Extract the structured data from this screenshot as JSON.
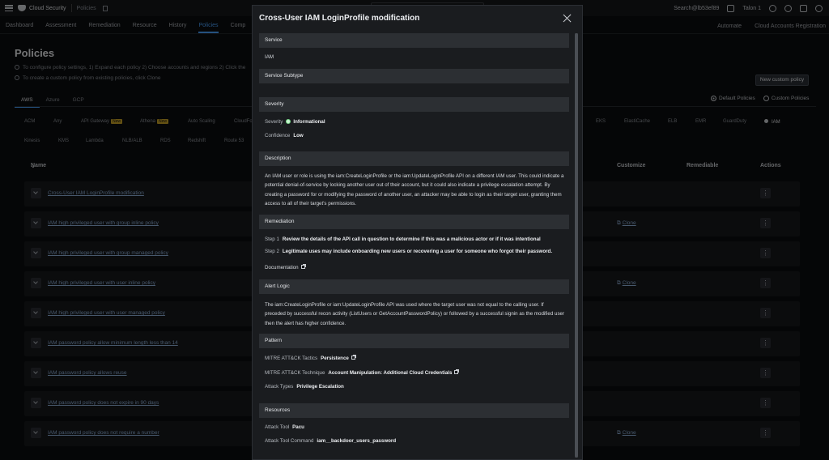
{
  "topbar": {
    "app_name": "Cloud Security",
    "crumb": "Policies",
    "search_label": "Search@lb53ef89",
    "tenant": "Talon 1"
  },
  "nav": {
    "items": [
      "Dashboard",
      "Assessment",
      "Remediation",
      "Resource",
      "History",
      "Policies",
      "Comp"
    ],
    "active": "Policies",
    "right": [
      "Automate",
      "Cloud Accounts Registration"
    ]
  },
  "page": {
    "title": "Policies",
    "hint1": "To configure policy settings, 1) Expand each policy 2) Choose accounts and regions 2) Click the",
    "hint2": "To create a custom policy from existing policies, click Clone",
    "cloud_tabs": [
      "AWS",
      "Azure",
      "GCP"
    ],
    "new_policy_btn": "New custom policy",
    "radios": [
      "Default Policies",
      "Custom Policies"
    ],
    "services_row1": [
      {
        "name": "ACM",
        "new": false
      },
      {
        "name": "Any",
        "new": false
      },
      {
        "name": "API Gateway",
        "new": true
      },
      {
        "name": "Athena",
        "new": true
      },
      {
        "name": "Auto Scaling",
        "new": false
      },
      {
        "name": "CloudFo",
        "new": false
      },
      {
        "name": "EKS",
        "new": false
      },
      {
        "name": "ElastiCache",
        "new": false
      },
      {
        "name": "ELB",
        "new": false
      },
      {
        "name": "EMR",
        "new": false
      },
      {
        "name": "GuardDuty",
        "new": false
      },
      {
        "name": "IAM",
        "new": false
      }
    ],
    "services_row2": [
      {
        "name": "Kinesis"
      },
      {
        "name": "KMS"
      },
      {
        "name": "Lambda"
      },
      {
        "name": "NLB/ALB"
      },
      {
        "name": "RDS"
      },
      {
        "name": "Redshift"
      },
      {
        "name": "Route 53"
      }
    ],
    "new_badge": "New",
    "columns": {
      "name": "Name",
      "customize": "Customize",
      "remediable": "Remediable",
      "actions": "Actions"
    },
    "clone_label": "Clone",
    "rows": [
      {
        "name": "Cross-User IAM LoginProfile modification",
        "clone": false
      },
      {
        "name": "IAM high privileged user with group inline policy",
        "clone": true
      },
      {
        "name": "IAM high privileged user with group managed policy",
        "clone": false
      },
      {
        "name": "IAM high privileged user with user inline policy",
        "clone": true
      },
      {
        "name": "IAM high privileged user with user managed policy",
        "clone": false
      },
      {
        "name": "IAM password policy allow minimum length less than 14",
        "clone": false
      },
      {
        "name": "IAM password policy allows reuse",
        "clone": false
      },
      {
        "name": "IAM password policy does not expire in 90 days",
        "clone": false
      },
      {
        "name": "IAM password policy does not require a number",
        "clone": true
      }
    ],
    "row_action": "⋮"
  },
  "modal": {
    "title": "Cross-User IAM LoginProfile modification",
    "service_header": "Service",
    "service_value": "IAM",
    "subtype_header": "Service Subtype",
    "severity_header": "Severity",
    "severity_label": "Severity",
    "severity_value": "Informational",
    "confidence_label": "Confidence",
    "confidence_value": "Low",
    "description_header": "Description",
    "description": "An IAM user or role is using the iam:CreateLoginProfile or the iam:UpdateLoginProfile API on a different IAM user. This could indicate a potential denial-of-service by locking another user out of their account, but it could also indicate a privilege escalation attempt. By creating a password for or modifying the password of another user, an attacker may be able to login as their target user, granting them access to all of their target's permissions.",
    "remediation_header": "Remediation",
    "step1_label": "Step 1",
    "step1": "Review the details of the API call in question to determine if this was a malicious actor or if it was intentional",
    "step2_label": "Step 2",
    "step2": "Legitimate uses may include onboarding new users or recovering a user for someone who forgot their password.",
    "documentation": "Documentation",
    "alert_header": "Alert Logic",
    "alert": "The iam:CreateLoginProfile or iam:UpdateLoginProfile API was used where the target user was not equal to the calling user. If preceded by successful recon activity (ListUsers or GetAccountPasswordPolicy) or followed by a successful signin as the modified user then the alert has higher confidence.",
    "pattern_header": "Pattern",
    "tactics_label": "MITRE ATT&CK Tactics",
    "tactics_value": "Persistence",
    "technique_label": "MITRE ATT&CK Technique",
    "technique_value": "Account Manipulation: Additional Cloud Credentials",
    "attack_types_label": "Attack Types",
    "attack_types_value": "Privilege Escalation",
    "resources_header": "Resources",
    "tool_label": "Attack Tool",
    "tool_value": "Pacu",
    "command_label": "Attack Tool Command",
    "command_value": "iam__backdoor_users_password"
  }
}
